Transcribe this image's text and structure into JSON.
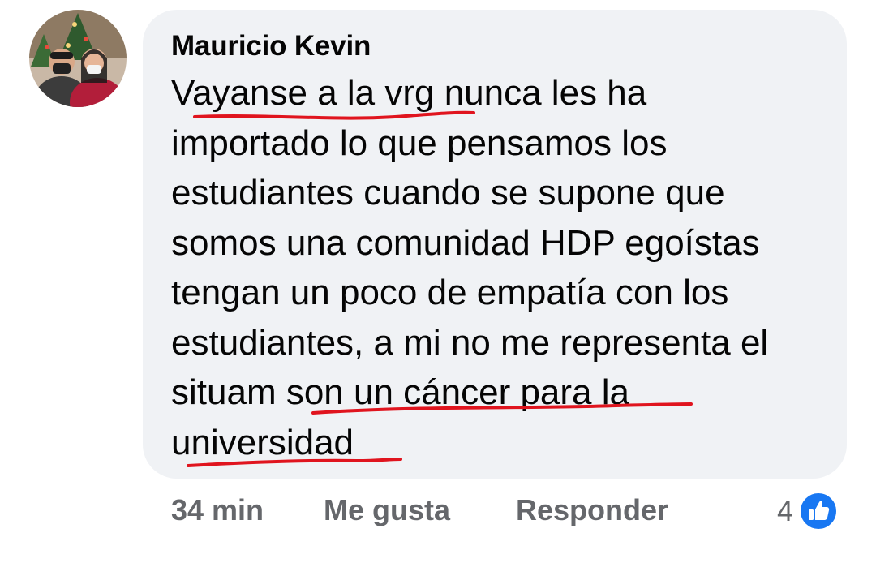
{
  "comment": {
    "author": "Mauricio Kevin",
    "text_lines": [
      "Vayanse a la vrg nunca les ha",
      "importado lo que pensamos los",
      "estudiantes cuando se supone que",
      "somos una comunidad HDP egoístas",
      "tengan un poco de empatía con los",
      "estudiantes, a mi no me representa el",
      "situam son un cáncer para la",
      "universidad"
    ],
    "timestamp": "34 min",
    "like_label": "Me gusta",
    "reply_label": "Responder",
    "reaction_count": "4",
    "reaction_icon": "thumbs-up-icon",
    "annotation_color": "#e0141e",
    "bubble_color": "#f0f2f5",
    "like_color": "#1877f2"
  }
}
